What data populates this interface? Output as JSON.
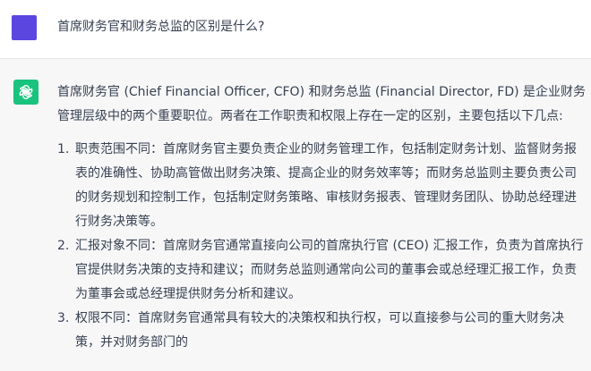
{
  "user": {
    "message": "首席财务官和财务总监的区别是什么?"
  },
  "assistant": {
    "intro": "首席财务官 (Chief Financial Officer, CFO) 和财务总监 (Financial Director, FD) 是企业财务管理层级中的两个重要职位。两者在工作职责和权限上存在一定的区别，主要包括以下几点:",
    "items": [
      {
        "number": "1.",
        "text": "职责范围不同：首席财务官主要负责企业的财务管理工作，包括制定财务计划、监督财务报表的准确性、协助高管做出财务决策、提高企业的财务效率等；而财务总监则主要负责公司的财务规划和控制工作，包括制定财务策略、审核财务报表、管理财务团队、协助总经理进行财务决策等。"
      },
      {
        "number": "2.",
        "text": "汇报对象不同：首席财务官通常直接向公司的首席执行官 (CEO) 汇报工作，负责为首席执行官提供财务决策的支持和建议；而财务总监则通常向公司的董事会或总经理汇报工作，负责为董事会或总经理提供财务分析和建议。"
      },
      {
        "number": "3.",
        "text": "权限不同：首席财务官通常具有较大的决策权和执行权，可以直接参与公司的重大财务决策，并对财务部门的"
      }
    ]
  },
  "colors": {
    "user_avatar": "#5b46e0",
    "assistant_avatar": "#19c37d",
    "assistant_bg": "#f7f7f8",
    "text": "#374151"
  },
  "icons": {
    "assistant_avatar": "openai-logo-icon"
  }
}
